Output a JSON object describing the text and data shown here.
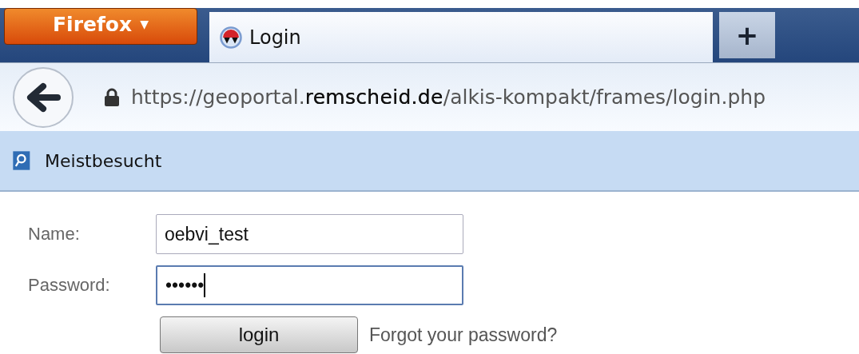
{
  "app_menu": {
    "label": "Firefox",
    "caret": "▼"
  },
  "tabs": [
    {
      "title": "Login",
      "selected": true
    }
  ],
  "new_tab": {
    "label": "+"
  },
  "address_bar": {
    "url": "https://geoportal.**remscheid.de**/alkis-kompakt/frames/login.php",
    "secure": true
  },
  "bookmarks_bar": {
    "items": [
      {
        "label": "Meistbesucht"
      }
    ]
  },
  "login_form": {
    "fields": [
      {
        "label": "Name:",
        "value": "oebvi_test",
        "focused": false
      },
      {
        "label": "Password:",
        "value": "••••••",
        "focused": true
      }
    ],
    "button": "login",
    "link": "Forgot your password?"
  }
}
